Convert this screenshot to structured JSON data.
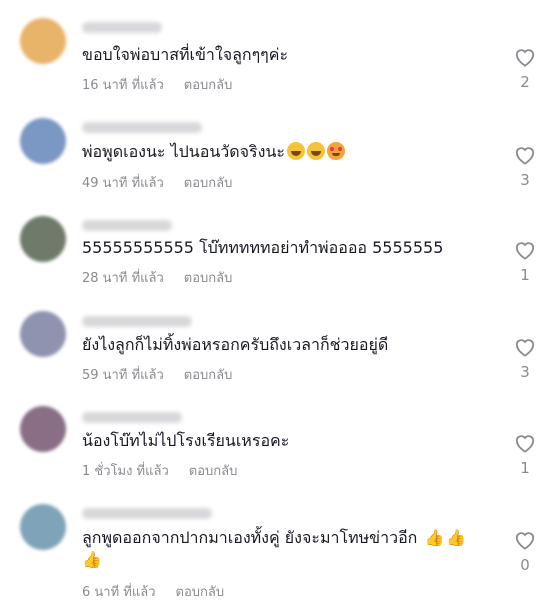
{
  "comments": [
    {
      "text": "ขอบใจพ่อบาสที่เข้าใจลูกๆๆค่ะ",
      "time": "16 นาที ที่แล้ว",
      "reply": "ตอบกลับ",
      "likes": "2",
      "avatar_color": "#e8b46a"
    },
    {
      "text": "พ่อพูดเองนะ ไปนอนวัดจริงนะ",
      "time": "49 นาที ที่แล้ว",
      "reply": "ตอบกลับ",
      "likes": "3",
      "avatar_color": "#7b97c4",
      "emojis": [
        "rofl-emoji",
        "rofl-emoji",
        "smiling-face-with-hearts-emoji"
      ]
    },
    {
      "text": "55555555555 โบ๊ทททททอย่าทำพ่ออออ 5555555",
      "time": "28 นาที ที่แล้ว",
      "reply": "ตอบกลับ",
      "likes": "1",
      "avatar_color": "#6e7a6a"
    },
    {
      "text": "ยังไงลูกก็ไม่ทิ้งพ่อหรอกครับถึงเวลาก็ช่วยอยู่ดี",
      "time": "59 นาที ที่แล้ว",
      "reply": "ตอบกลับ",
      "likes": "3",
      "avatar_color": "#8e93b0"
    },
    {
      "text": "น้องโบ๊ทไม่ไปโรงเรียนเหรอคะ",
      "time": "1 ชั่วโมง ที่แล้ว",
      "reply": "ตอบกลับ",
      "likes": "1",
      "avatar_color": "#8a6e86"
    },
    {
      "text": "ลูกพูดออกจากปากมาเองทั้งคู่ ยังจะมาโทษข่าวอีก",
      "time": "6 นาที ที่แล้ว",
      "reply": "ตอบกลับ",
      "likes": "0",
      "avatar_color": "#7fa3b8",
      "emojis": [
        "thumbs-up-emoji",
        "thumbs-up-emoji",
        "thumbs-up-emoji"
      ]
    }
  ]
}
